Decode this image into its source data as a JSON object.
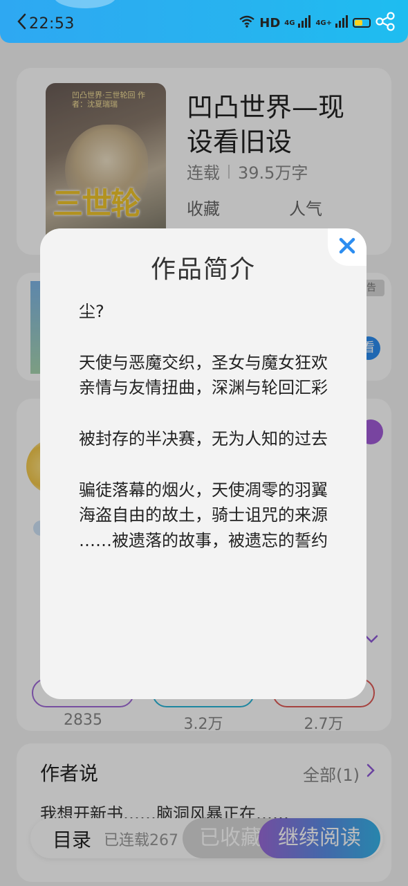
{
  "status_bar": {
    "time": "22:53",
    "hd_label": "HD",
    "network_1": "4G",
    "network_2": "4G+"
  },
  "book": {
    "cover_top_text": "凹凸世界·三世轮回 作者：沈夏瑞瑞",
    "cover_logo": "三世轮回",
    "title": "凹凸世界—现设看旧设",
    "status": "连载",
    "word_count": "39.5万字",
    "fav_label": "收藏",
    "pop_label": "人气"
  },
  "ad": {
    "tag": "告",
    "watch": "看"
  },
  "ranks": {
    "values": [
      "2835",
      "3.2万",
      "2.7万"
    ]
  },
  "author": {
    "title": "作者说",
    "all_label": "全部(1)",
    "note": "我想开新书……脑洞风暴正在……"
  },
  "bottom_bar": {
    "toc_label": "目录",
    "serial_label": "已连载267",
    "collected_label": "已收藏",
    "continue_label": "继续阅读"
  },
  "modal": {
    "title": "作品简介",
    "paragraphs": [
      "尘?",
      "",
      "天使与恶魔交织，圣女与魔女狂欢",
      "亲情与友情扭曲，深渊与轮回汇彩",
      "",
      "被封存的半决赛，无为人知的过去",
      "",
      "骗徒落幕的烟火，天使凋零的羽翼",
      "海盗自由的故土，骑士诅咒的来源",
      "……被遗落的故事，被遗忘的誓约"
    ]
  },
  "colors": {
    "status_bar_start": "#2ea8f2",
    "status_bar_end": "#1ebdf0",
    "accent_purple": "#a35cd8",
    "close_icon": "#2c8df0",
    "continue_gradient": [
      "#9a6ad8",
      "#36b4e8"
    ]
  }
}
